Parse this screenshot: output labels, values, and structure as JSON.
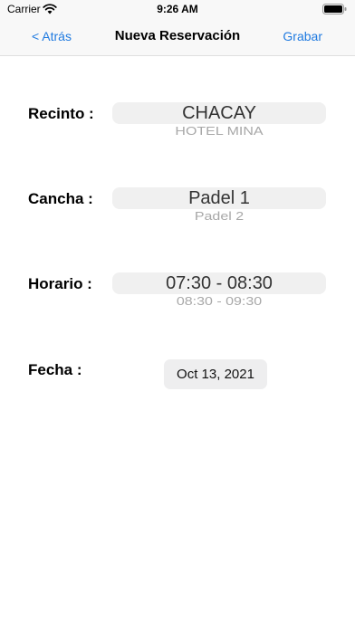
{
  "status_bar": {
    "carrier": "Carrier",
    "time": "9:26 AM"
  },
  "nav": {
    "back_label": "< Atrás",
    "title": "Nueva Reservación",
    "save_label": "Grabar"
  },
  "form": {
    "recinto": {
      "label": "Recinto :",
      "selected": "CHACAY",
      "next": "HOTEL MINA"
    },
    "cancha": {
      "label": "Cancha :",
      "selected": "Padel 1",
      "next": "Padel 2"
    },
    "horario": {
      "label": "Horario :",
      "selected": "07:30 - 08:30",
      "next": "08:30 - 09:30"
    },
    "fecha": {
      "label": "Fecha :",
      "value": "Oct 13, 2021"
    }
  },
  "colors": {
    "accent": "#1f7ae0"
  }
}
